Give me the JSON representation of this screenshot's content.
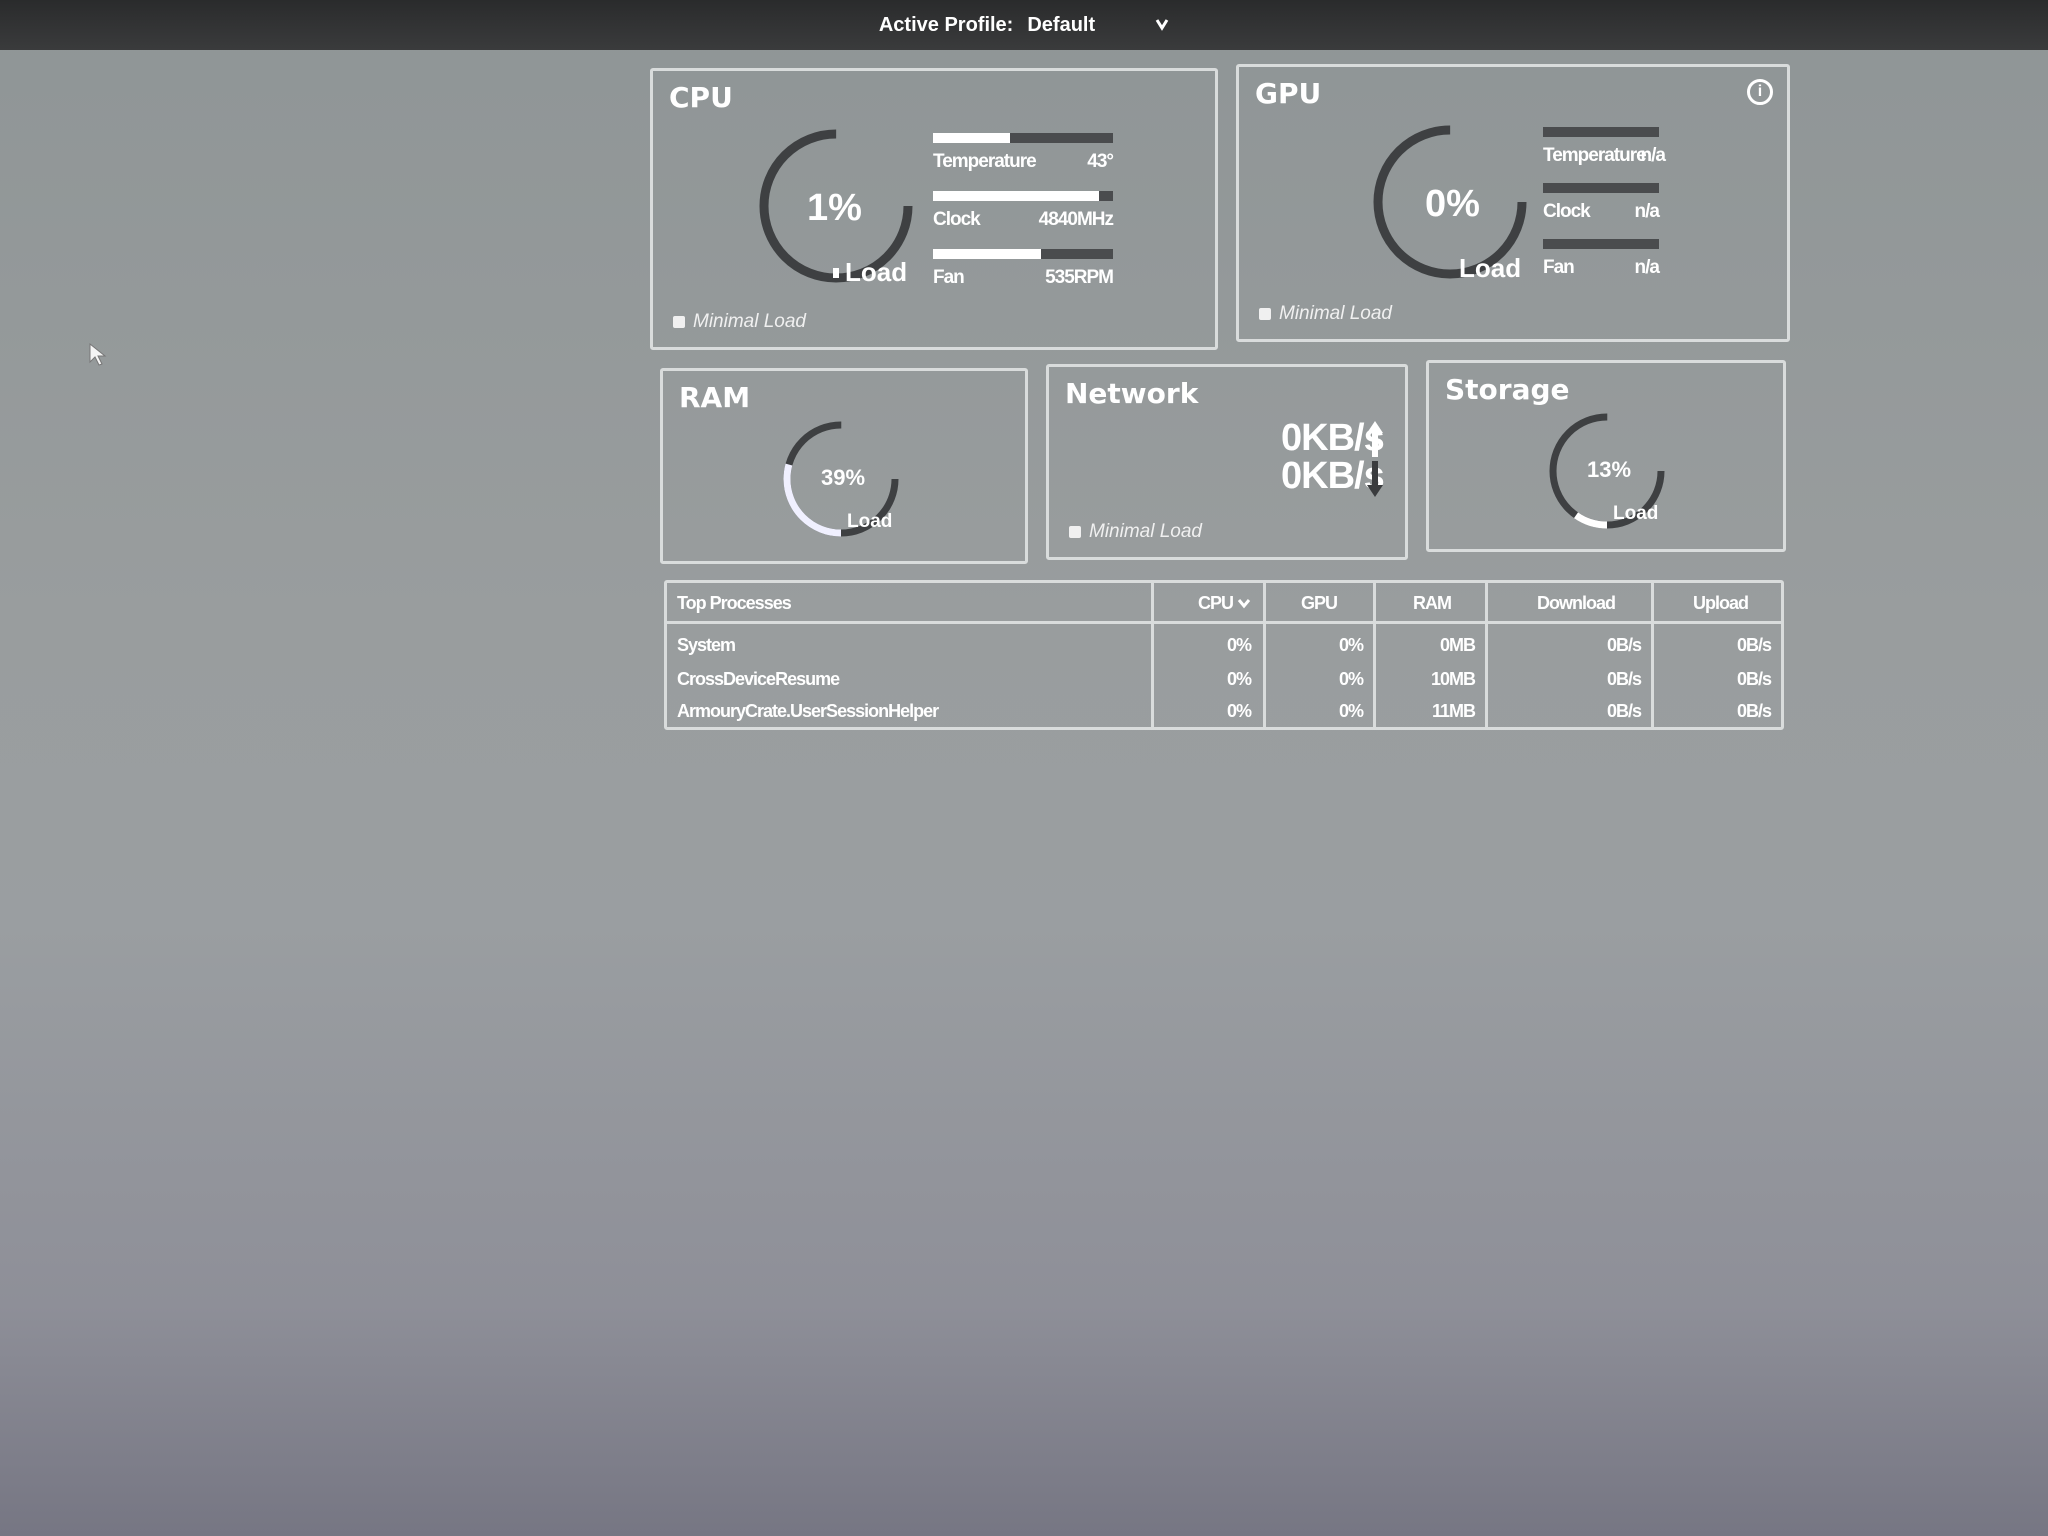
{
  "topbar": {
    "profile_label": "Active Profile:",
    "profile_value": "Default"
  },
  "cpu": {
    "title": "CPU",
    "load_value": "1%",
    "load_percent": 1,
    "load_label": "Load",
    "status": "Minimal Load",
    "metrics": [
      {
        "label": "Temperature",
        "value": "43°",
        "fill": 0.43
      },
      {
        "label": "Clock",
        "value": "4840MHz",
        "fill": 0.92
      },
      {
        "label": "Fan",
        "value": "535RPM",
        "fill": 0.6
      }
    ]
  },
  "gpu": {
    "title": "GPU",
    "load_value": "0%",
    "load_percent": 0,
    "load_label": "Load",
    "status": "Minimal Load",
    "metrics": [
      {
        "label": "Temperature",
        "value": "n/a"
      },
      {
        "label": "Clock",
        "value": "n/a"
      },
      {
        "label": "Fan",
        "value": "n/a"
      }
    ]
  },
  "ram": {
    "title": "RAM",
    "load_value": "39%",
    "load_percent": 39,
    "load_label": "Load"
  },
  "network": {
    "title": "Network",
    "upload": "0KB/s",
    "download": "0KB/s",
    "status": "Minimal Load"
  },
  "storage": {
    "title": "Storage",
    "load_value": "13%",
    "load_percent": 13,
    "load_label": "Load"
  },
  "processes": {
    "columns": [
      "Top Processes",
      "CPU",
      "GPU",
      "RAM",
      "Download",
      "Upload"
    ],
    "rows": [
      [
        "System",
        "0%",
        "0%",
        "0MB",
        "0B/s",
        "0B/s"
      ],
      [
        "CrossDeviceResume",
        "0%",
        "0%",
        "10MB",
        "0B/s",
        "0B/s"
      ],
      [
        "ArmouryCrate.UserSessionHelper",
        "0%",
        "0%",
        "11MB",
        "0B/s",
        "0B/s"
      ]
    ]
  },
  "colors": {
    "accent": "#ffffff",
    "track": "#3e4042",
    "border": "#d9dcdc"
  }
}
